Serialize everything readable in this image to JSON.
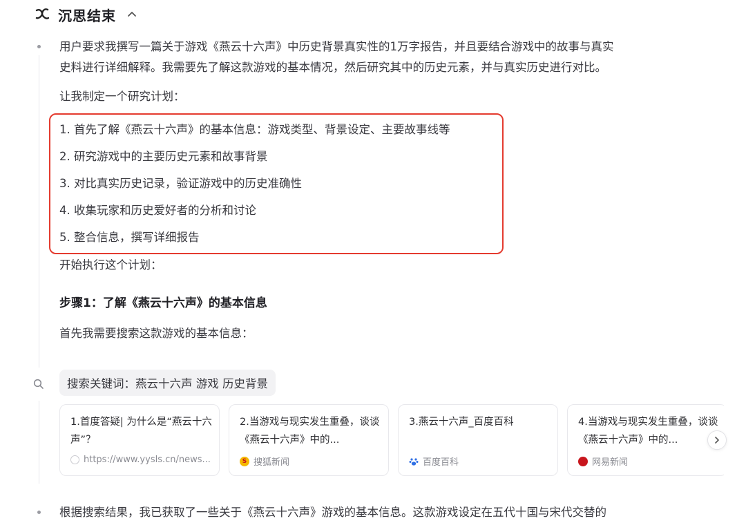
{
  "header": {
    "title": "沉思结束",
    "logo_icon": "sparkle-logo-icon",
    "collapse_icon": "chevron-up-icon"
  },
  "intro": {
    "line1": "用户要求我撰写一篇关于游戏《燕云十六声》中历史背景真实性的1万字报告，并且要结合游戏中的故事与真实",
    "line2": "史料进行详细解释。我需要先了解这款游戏的基本情况，然后研究其中的历史元素，并与真实历史进行对比。"
  },
  "plan_intro": "让我制定一个研究计划：",
  "plan": [
    "1. 首先了解《燕云十六声》的基本信息：游戏类型、背景设定、主要故事线等",
    "2. 研究游戏中的主要历史元素和故事背景",
    "3. 对比真实历史记录，验证游戏中的历史准确性",
    "4. 收集玩家和历史爱好者的分析和讨论",
    "5. 整合信息，撰写详细报告"
  ],
  "execute": "开始执行这个计划：",
  "step1": "步骤1：了解《燕云十六声》的基本信息",
  "search_need": "首先我需要搜索这款游戏的基本信息：",
  "search": {
    "label": "搜索关键词：燕云十六声 游戏 历史背景",
    "icon": "search-icon"
  },
  "results": [
    {
      "title": "1.首度答疑| 为什么是“燕云十六声”？",
      "source": "https://www.yysls.cn/news...",
      "icon": "globe-icon",
      "color": "#c9c9cf"
    },
    {
      "title": "2.当游戏与现实发生重叠，谈谈《燕云十六声》中的...",
      "source": "搜狐新闻",
      "icon": "sohu-icon",
      "color": "#f5b800"
    },
    {
      "title": "3.燕云十六声_百度百科",
      "source": "百度百科",
      "icon": "baidu-paw-icon",
      "color": "#2f6fe4"
    },
    {
      "title": "4.当游戏与现实发生重叠，谈谈《燕云十六声》中的...",
      "source": "网易新闻",
      "icon": "netease-icon",
      "color": "#c8161d"
    }
  ],
  "next_icon": "chevron-right-icon",
  "conclusion": "根据搜索结果，我已获取了一些关于《燕云十六声》游戏的基本信息。这款游戏设定在五代十国与宋代交替的"
}
